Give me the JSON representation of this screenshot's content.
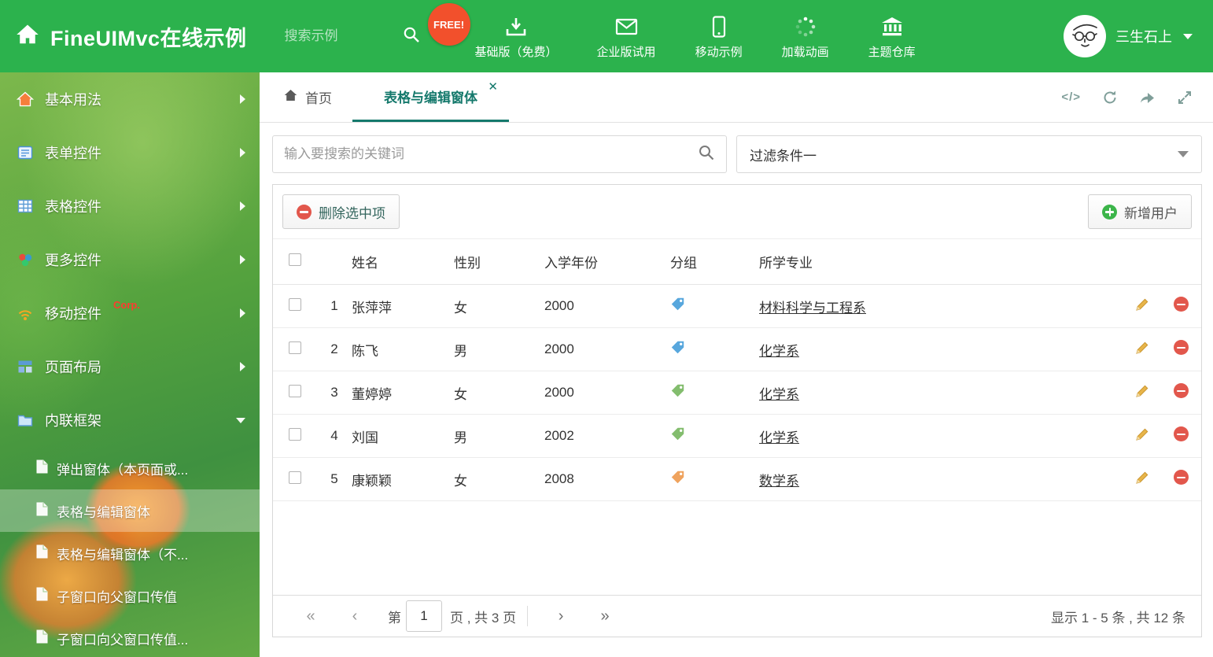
{
  "header": {
    "app_title": "FineUIMvc在线示例",
    "search_placeholder": "搜索示例",
    "free_badge": "FREE!",
    "nav": [
      {
        "label": "基础版（免费）",
        "icon": "download-icon"
      },
      {
        "label": "企业版试用",
        "icon": "mail-icon"
      },
      {
        "label": "移动示例",
        "icon": "mobile-icon"
      },
      {
        "label": "加载动画",
        "icon": "spinner-icon"
      },
      {
        "label": "主题仓库",
        "icon": "bank-icon"
      }
    ],
    "username": "三生石上"
  },
  "sidebar": {
    "items": [
      {
        "label": "基本用法",
        "icon": "home-icon"
      },
      {
        "label": "表单控件",
        "icon": "form-icon"
      },
      {
        "label": "表格控件",
        "icon": "table-icon"
      },
      {
        "label": "更多控件",
        "icon": "more-icon"
      },
      {
        "label": "移动控件",
        "badge": "Corp.",
        "icon": "signal-icon"
      },
      {
        "label": "页面布局",
        "icon": "layout-icon"
      },
      {
        "label": "内联框架",
        "icon": "folder-icon"
      }
    ],
    "subitems": [
      {
        "label": "弹出窗体（本页面或..."
      },
      {
        "label": "表格与编辑窗体",
        "active": true
      },
      {
        "label": "表格与编辑窗体（不..."
      },
      {
        "label": "子窗口向父窗口传值"
      },
      {
        "label": "子窗口向父窗口传值..."
      }
    ]
  },
  "tabs": {
    "home_label": "首页",
    "active_label": "表格与编辑窗体"
  },
  "filter": {
    "search_placeholder": "输入要搜索的关键词",
    "dropdown_value": "过滤条件一"
  },
  "toolbar": {
    "delete_label": "删除选中项",
    "add_label": "新增用户"
  },
  "table": {
    "headers": {
      "name": "姓名",
      "gender": "性别",
      "year": "入学年份",
      "group": "分组",
      "major": "所学专业"
    },
    "rows": [
      {
        "num": "1",
        "name": "张萍萍",
        "gender": "女",
        "year": "2000",
        "tag_color": "#58a7dd",
        "major": "材料科学与工程系"
      },
      {
        "num": "2",
        "name": "陈飞",
        "gender": "男",
        "year": "2000",
        "tag_color": "#58a7dd",
        "major": "化学系"
      },
      {
        "num": "3",
        "name": "董婷婷",
        "gender": "女",
        "year": "2000",
        "tag_color": "#83bd6e",
        "major": "化学系"
      },
      {
        "num": "4",
        "name": "刘国",
        "gender": "男",
        "year": "2002",
        "tag_color": "#83bd6e",
        "major": "化学系"
      },
      {
        "num": "5",
        "name": "康颖颖",
        "gender": "女",
        "year": "2008",
        "tag_color": "#efa35e",
        "major": "数学系"
      }
    ]
  },
  "pagination": {
    "page_prefix": "第",
    "current_page": "1",
    "page_suffix": "页 , 共 3 页",
    "summary": "显示 1 - 5 条 , 共 12 条"
  },
  "colors": {
    "header_green": "#2cb24d",
    "accent_teal": "#15796c",
    "delete_red": "#e2574c",
    "add_green": "#3cb54a",
    "free_badge_bg": "#f2502c"
  }
}
